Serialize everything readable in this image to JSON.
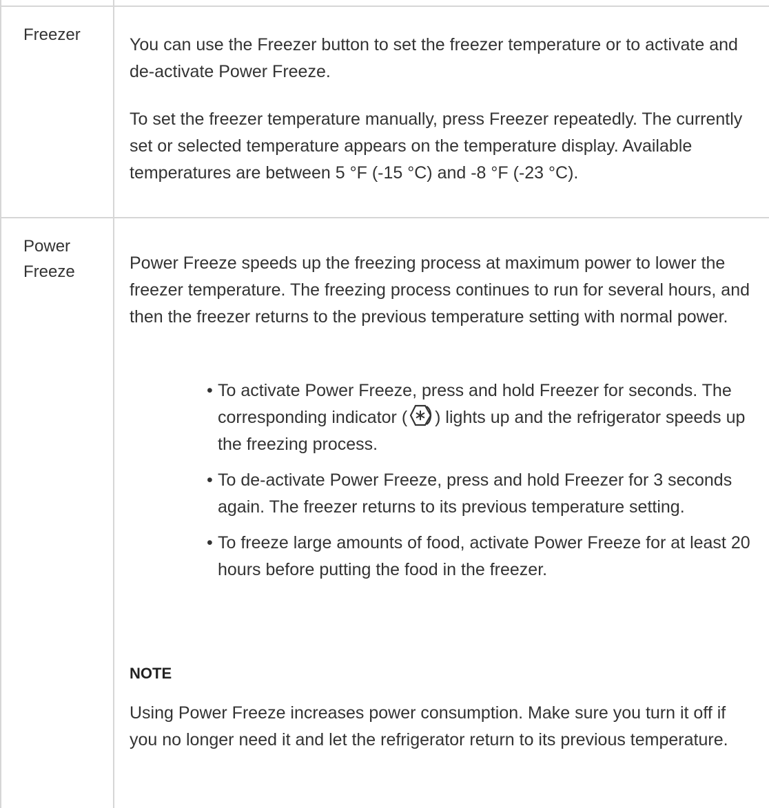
{
  "rows": [
    {
      "label": "Freezer",
      "paragraphs": [
        "You can use the Freezer button to set the freezer temperature or to activate and de-activate Power Freeze.",
        "To set the freezer temperature manually, press Freezer repeatedly. The currently set or selected temperature appears on the temperature display. Available temperatures are between 5 °F (-15 °C) and -8 °F (-23 °C)."
      ]
    },
    {
      "label": "Power Freeze",
      "intro": "Power Freeze speeds up the freezing process at maximum power to lower the freezer temperature. The freezing process continues to run for several hours, and then the freezer returns to the previous temperature setting with normal power.",
      "bullets": [
        {
          "before_icon": "To activate Power Freeze, press and hold Freezer for seconds. The corresponding indicator (",
          "icon": "power-freeze-icon",
          "after_icon": ") lights up and the refrigerator speeds up the freezing process."
        },
        {
          "text": "To de-activate Power Freeze, press and hold Freezer for 3 seconds again. The freezer returns to its previous temperature setting."
        },
        {
          "text": "To freeze large amounts of food, activate Power Freeze for at least 20 hours before putting the food in the freezer."
        }
      ],
      "note_heading": "NOTE",
      "note_text": "Using Power Freeze increases power consumption. Make sure you turn it off if you no longer need it and let the refrigerator return to its previous temperature."
    }
  ],
  "bullet_char": "•",
  "colors": {
    "border": "#d6d6d6",
    "text": "#333333"
  }
}
